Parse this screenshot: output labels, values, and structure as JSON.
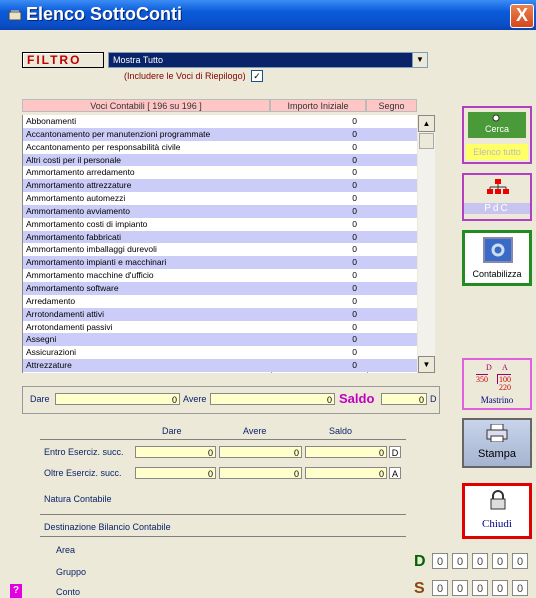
{
  "window": {
    "title": "Elenco SottoConti",
    "close_label": "X"
  },
  "filter": {
    "label": "FILTRO",
    "selected": "Mostra Tutto",
    "include_label": "(Includere le Voci di Riepilogo)",
    "include_checked": "✓"
  },
  "table": {
    "headers": [
      "Voci Contabili [ 196 su 196 ]",
      "Importo Iniziale",
      "Segno"
    ],
    "rows": [
      {
        "name": "Abbonamenti",
        "value": "0"
      },
      {
        "name": "Accantonamento per manutenzioni programmate",
        "value": "0"
      },
      {
        "name": "Accantonamento per responsabilità civile",
        "value": "0"
      },
      {
        "name": "Altri costi per il personale",
        "value": "0"
      },
      {
        "name": "Ammortamento arredamento",
        "value": "0"
      },
      {
        "name": "Ammortamento attrezzature",
        "value": "0"
      },
      {
        "name": "Ammortamento automezzi",
        "value": "0"
      },
      {
        "name": "Ammortamento avviamento",
        "value": "0"
      },
      {
        "name": "Ammortamento costi di impianto",
        "value": "0"
      },
      {
        "name": "Ammortamento fabbricati",
        "value": "0"
      },
      {
        "name": "Ammortamento imballaggi durevoli",
        "value": "0"
      },
      {
        "name": "Ammortamento impianti e macchinari",
        "value": "0"
      },
      {
        "name": "Ammortamento macchine d'ufficio",
        "value": "0"
      },
      {
        "name": "Ammortamento software",
        "value": "0"
      },
      {
        "name": "Arredamento",
        "value": "0"
      },
      {
        "name": "Arrotondamenti attivi",
        "value": "0"
      },
      {
        "name": "Arrotondamenti passivi",
        "value": "0"
      },
      {
        "name": "Assegni",
        "value": "0"
      },
      {
        "name": "Assicurazioni",
        "value": "0"
      },
      {
        "name": "Attrezzature",
        "value": "0"
      }
    ]
  },
  "totals": {
    "dare_label": "Dare",
    "dare": "0",
    "avere_label": "Avere",
    "avere": "0",
    "saldo_label": "Saldo",
    "saldo": "0",
    "saldo_sign": "D"
  },
  "summary": {
    "col_dare": "Dare",
    "col_avere": "Avere",
    "col_saldo": "Saldo",
    "entro_label": "Entro Eserciz. succ.",
    "entro_dare": "0",
    "entro_avere": "0",
    "entro_saldo": "0",
    "entro_sign": "D",
    "oltre_label": "Oltre Eserciz. succ.",
    "oltre_dare": "0",
    "oltre_avere": "0",
    "oltre_saldo": "0",
    "oltre_sign": "A"
  },
  "info": {
    "natura": "Natura Contabile",
    "destinazione": "Destinazione Bilancio Contabile",
    "area": "Area",
    "gruppo": "Gruppo",
    "conto": "Conto"
  },
  "buttons": {
    "cerca": "Cerca",
    "elenco_tutto": "Elenco tutto",
    "pdc": "PdC",
    "contabilizza": "Contabilizza",
    "mastrino": "Mastrino",
    "mastrino_d": "D",
    "mastrino_a": "A",
    "mastrino_350": "350",
    "mastrino_100": "100",
    "mastrino_220": "220",
    "stampa": "Stampa",
    "chiudi": "Chiudi",
    "help": "?"
  },
  "counters": {
    "d_label": "D",
    "s_label": "S",
    "d_values": [
      "0",
      "0",
      "0",
      "0",
      "0"
    ],
    "s_values": [
      "0",
      "0",
      "0",
      "0",
      "0"
    ]
  }
}
